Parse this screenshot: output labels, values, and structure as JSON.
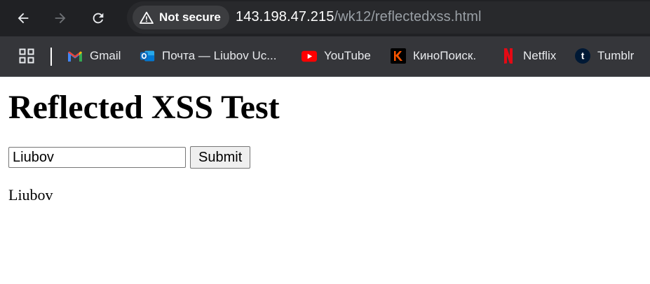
{
  "browser": {
    "security_label": "Not secure",
    "url_host": "143.198.47.215",
    "url_path": "/wk12/reflectedxss.html",
    "nav": {
      "back_icon": "arrow-left-icon",
      "forward_icon": "arrow-right-icon",
      "reload_icon": "reload-icon"
    }
  },
  "bookmarks": [
    {
      "label": "Gmail",
      "icon": "gmail-icon",
      "color": "#ea4335"
    },
    {
      "label": "Почта — Liubov Uc...",
      "icon": "outlook-icon",
      "color": "#0f6cbd"
    },
    {
      "label": "YouTube",
      "icon": "youtube-icon",
      "color": "#ff0000"
    },
    {
      "label": "КиноПоиск.",
      "icon": "kinopoisk-icon",
      "color": "#ff5500"
    },
    {
      "label": "Netflix",
      "icon": "netflix-icon",
      "color": "#e50914"
    },
    {
      "label": "Tumblr",
      "icon": "tumblr-icon",
      "color": "#001935"
    }
  ],
  "page": {
    "title": "Reflected XSS Test",
    "input_value": "Liubov",
    "submit_label": "Submit",
    "reflected_output": "Liubov"
  }
}
